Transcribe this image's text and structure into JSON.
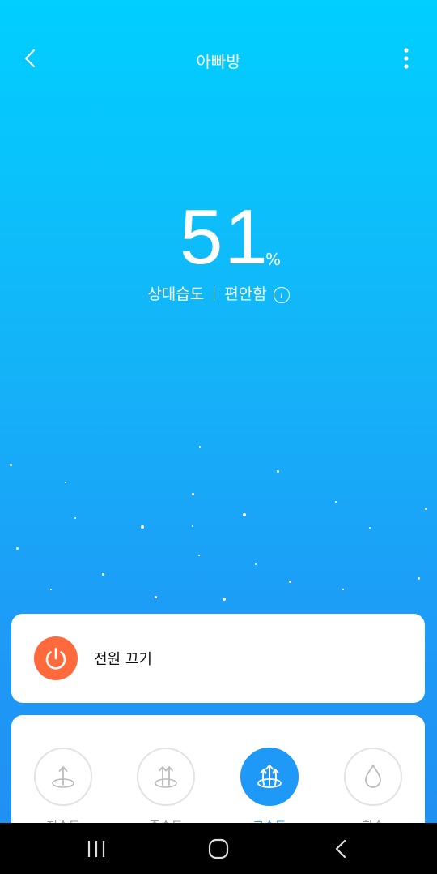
{
  "header": {
    "title": "아빠방"
  },
  "humidity": {
    "value": "51",
    "unit": "%",
    "label": "상대습도",
    "status": "편안함"
  },
  "power": {
    "label": "전원 끄기"
  },
  "modes": [
    {
      "label": "저속도",
      "icon": "single-arrow-icon",
      "active": false
    },
    {
      "label": "중속도",
      "icon": "double-arrow-icon",
      "active": false
    },
    {
      "label": "고속도",
      "icon": "triple-arrow-icon",
      "active": true
    },
    {
      "label": "항습",
      "icon": "water-drop-icon",
      "active": false
    }
  ],
  "colors": {
    "accent": "#1E99F7",
    "power": "#FF6A3D",
    "gradient_top": "#00CFFF",
    "gradient_bottom": "#1F8EF2"
  }
}
